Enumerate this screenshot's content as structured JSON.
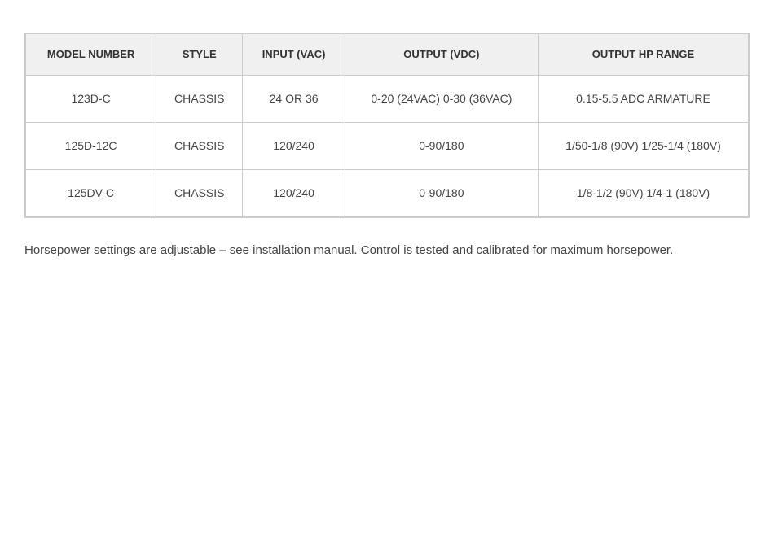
{
  "table": {
    "headers": [
      {
        "key": "model_number",
        "label": "MODEL NUMBER"
      },
      {
        "key": "style",
        "label": "STYLE"
      },
      {
        "key": "input_vac",
        "label": "INPUT (VAC)"
      },
      {
        "key": "output_vdc",
        "label": "OUTPUT (VDC)"
      },
      {
        "key": "output_hp_range",
        "label": "OUTPUT HP RANGE"
      }
    ],
    "rows": [
      {
        "model_number": "123D-C",
        "style": "CHASSIS",
        "input_vac": "24 OR 36",
        "output_vdc": "0-20 (24VAC) 0-30 (36VAC)",
        "output_hp_range": "0.15-5.5 ADC ARMATURE"
      },
      {
        "model_number": "125D-12C",
        "style": "CHASSIS",
        "input_vac": "120/240",
        "output_vdc": "0-90/180",
        "output_hp_range": "1/50-1/8 (90V) 1/25-1/4 (180V)"
      },
      {
        "model_number": "125DV-C",
        "style": "CHASSIS",
        "input_vac": "120/240",
        "output_vdc": "0-90/180",
        "output_hp_range": "1/8-1/2 (90V) 1/4-1 (180V)"
      }
    ]
  },
  "footer": {
    "text": "Horsepower settings are adjustable – see installation manual. Control is tested and calibrated for maximum horsepower."
  }
}
